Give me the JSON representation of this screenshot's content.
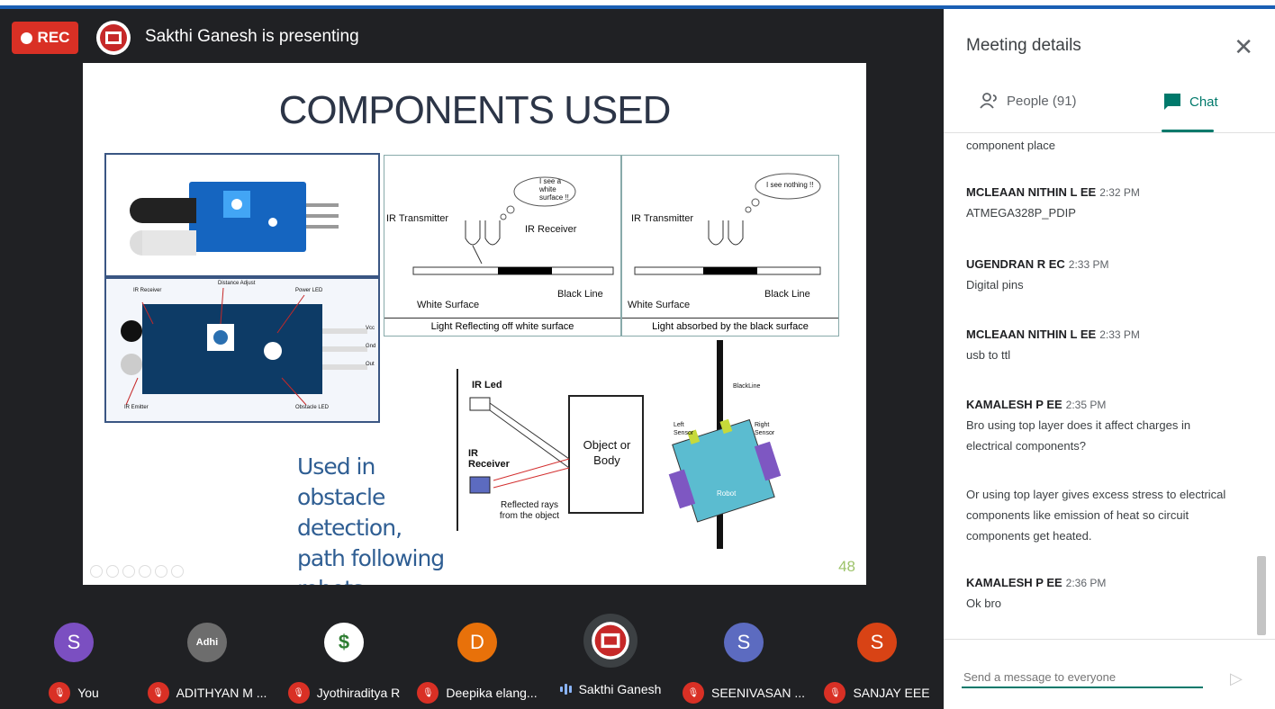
{
  "rec_label": "REC",
  "presenter": "Sakthi Ganesh is presenting",
  "slide": {
    "title": "COMPONENTS USED",
    "caption": "Used in obstacle detection, path following robots",
    "page_number": "48",
    "diagram1": {
      "bubble": "I see a white surface !!",
      "transmitter": "IR Transmitter",
      "receiver": "IR Receiver",
      "white_surface": "White Surface",
      "black_line": "Black Line",
      "caption": "Light Reflecting off white surface"
    },
    "diagram2": {
      "bubble": "I see nothing !!",
      "transmitter": "IR Transmitter",
      "white_surface": "White Surface",
      "black_line": "Black Line",
      "caption": "Light absorbed by the black surface"
    },
    "module_labels": {
      "ir_receiver": "IR Receiver",
      "distance_adjust": "Distance Adjust",
      "power_led": "Power LED",
      "vcc": "Vcc",
      "gnd": "Gnd",
      "out": "Out",
      "ir_emitter": "IR Emitter",
      "obstacle_led": "Obstacle LED"
    },
    "reflect_diagram": {
      "ir_led": "IR Led",
      "ir_receiver": "IR Receiver",
      "object": "Object or Body",
      "reflected": "Reflected rays from the object"
    },
    "robot_diagram": {
      "black_line": "BlackLine",
      "left_sensor": "Left Sensor",
      "right_sensor": "Right Sensor",
      "robot": "Robot"
    }
  },
  "participants": [
    {
      "name": "You",
      "initial": "S",
      "color": "#7b4fc1",
      "muted": true
    },
    {
      "name": "ADITHYAN M ...",
      "initial": "Adhi",
      "color": "#6d6d6d",
      "muted": true
    },
    {
      "name": "Jyothiraditya R",
      "initial": "$",
      "color": "#ffffff",
      "muted": true
    },
    {
      "name": "Deepika elang...",
      "initial": "D",
      "color": "#e8710a",
      "muted": true
    },
    {
      "name": "Sakthi Ganesh",
      "initial": "",
      "color": "#3c4043",
      "muted": false
    },
    {
      "name": "SEENIVASAN ...",
      "initial": "S",
      "color": "#5c6bc0",
      "muted": true
    },
    {
      "name": "SANJAY EEE",
      "initial": "S",
      "color": "#d84315",
      "muted": true
    }
  ],
  "panel": {
    "title": "Meeting details",
    "people_tab": "People (91)",
    "chat_tab": "Chat",
    "input_placeholder": "Send a message to everyone"
  },
  "messages": [
    {
      "who": "",
      "time": "",
      "body": "component place"
    },
    {
      "who": "MCLEAAN NITHIN L EE",
      "time": "2:32 PM",
      "body": "ATMEGA328P_PDIP"
    },
    {
      "who": "UGENDRAN R EC",
      "time": "2:33 PM",
      "body": "Digital pins"
    },
    {
      "who": "MCLEAAN NITHIN L EE",
      "time": "2:33 PM",
      "body": "usb to ttl"
    },
    {
      "who": "KAMALESH P EE",
      "time": "2:35 PM",
      "body": "Bro using top layer does it affect charges in electrical components?"
    },
    {
      "who": "",
      "time": "",
      "body": "Or using top layer gives excess stress to electrical components like emission of heat so circuit components get heated."
    },
    {
      "who": "KAMALESH P EE",
      "time": "2:36 PM",
      "body": "Ok bro"
    }
  ]
}
